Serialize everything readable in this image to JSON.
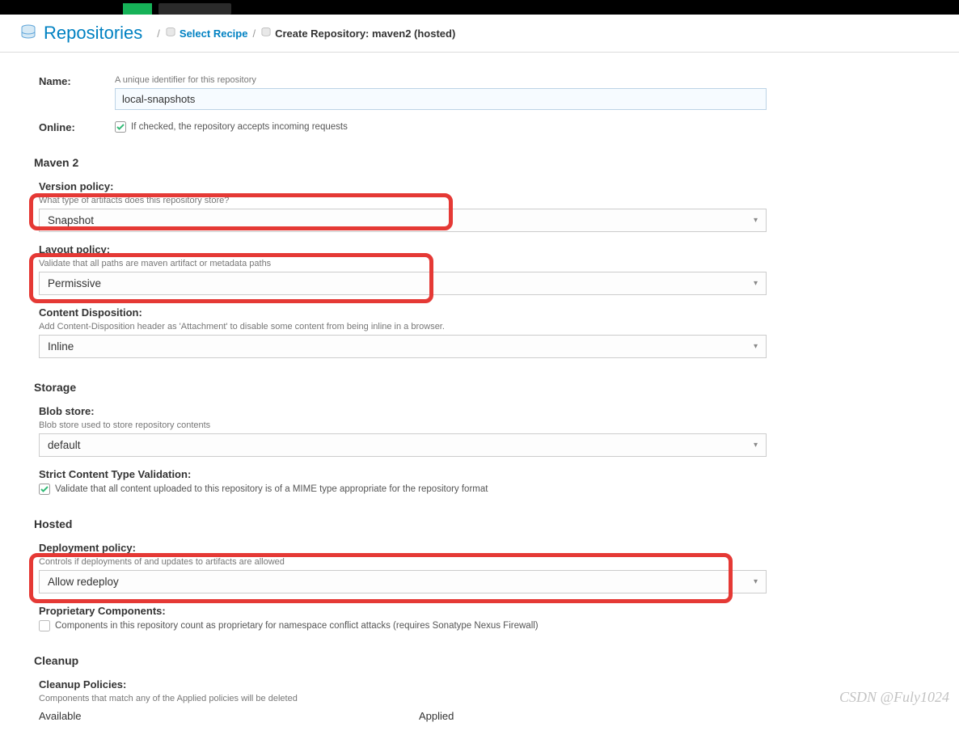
{
  "breadcrumb": {
    "title": "Repositories",
    "select_recipe": "Select Recipe",
    "current": "Create Repository: maven2 (hosted)"
  },
  "form": {
    "name_label": "Name:",
    "name_help": "A unique identifier for this repository",
    "name_value": "local-snapshots",
    "online_label": "Online:",
    "online_help": "If checked, the repository accepts incoming requests"
  },
  "maven2": {
    "section": "Maven 2",
    "version_policy_label": "Version policy:",
    "version_policy_help": "What type of artifacts does this repository store?",
    "version_policy_value": "Snapshot",
    "layout_policy_label": "Layout policy:",
    "layout_policy_help": "Validate that all paths are maven artifact or metadata paths",
    "layout_policy_value": "Permissive",
    "content_disposition_label": "Content Disposition:",
    "content_disposition_help": "Add Content-Disposition header as 'Attachment' to disable some content from being inline in a browser.",
    "content_disposition_value": "Inline"
  },
  "storage": {
    "section": "Storage",
    "blob_store_label": "Blob store:",
    "blob_store_help": "Blob store used to store repository contents",
    "blob_store_value": "default",
    "strict_label": "Strict Content Type Validation:",
    "strict_help": "Validate that all content uploaded to this repository is of a MIME type appropriate for the repository format"
  },
  "hosted": {
    "section": "Hosted",
    "deploy_label": "Deployment policy:",
    "deploy_help": "Controls if deployments of and updates to artifacts are allowed",
    "deploy_value": "Allow redeploy",
    "proprietary_label": "Proprietary Components:",
    "proprietary_help": "Components in this repository count as proprietary for namespace conflict attacks (requires Sonatype Nexus Firewall)"
  },
  "cleanup": {
    "section": "Cleanup",
    "policies_label": "Cleanup Policies:",
    "policies_help": "Components that match any of the Applied policies will be deleted",
    "available": "Available",
    "applied": "Applied"
  },
  "watermark": "CSDN @Fuly1024"
}
